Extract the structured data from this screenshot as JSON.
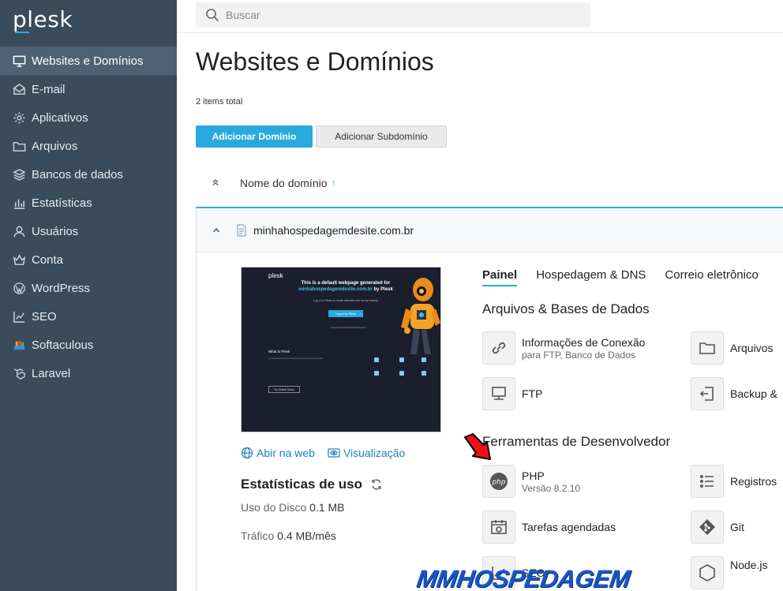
{
  "sidebar": {
    "logo": "plesk",
    "items": [
      {
        "label": "Websites e Domínios",
        "icon": "monitor-icon",
        "active": true
      },
      {
        "label": "E-mail",
        "icon": "envelope-icon"
      },
      {
        "label": "Aplicativos",
        "icon": "gear-icon"
      },
      {
        "label": "Arquivos",
        "icon": "folder-icon"
      },
      {
        "label": "Bancos de dados",
        "icon": "database-icon"
      },
      {
        "label": "Estatísticas",
        "icon": "bar-chart-icon"
      },
      {
        "label": "Usuários",
        "icon": "user-icon"
      },
      {
        "label": "Conta",
        "icon": "crown-icon"
      },
      {
        "label": "WordPress",
        "icon": "wordpress-icon"
      },
      {
        "label": "SEO",
        "icon": "trend-chart-icon"
      },
      {
        "label": "Softaculous",
        "icon": "softaculous-icon"
      },
      {
        "label": "Laravel",
        "icon": "laravel-icon"
      }
    ]
  },
  "search": {
    "placeholder": "Buscar"
  },
  "page": {
    "title": "Websites e Domínios",
    "items_total": "2 items total",
    "add_domain": "Adicionar Domínio",
    "add_subdomain": "Adicionar Subdomínio",
    "column_header": "Nome do domínio",
    "sort_arrow": "↑"
  },
  "domain": {
    "name": "minhahospedagemdesite.com.br",
    "open_web": "Abir na web",
    "preview": "Visualização",
    "thumbnail": {
      "logo": "plesk",
      "heading_1": "This is a default webpage generated for",
      "heading_2": "minhahospedagemdesite.com.br",
      "heading_3": " by Plesk",
      "sub": "Log in to Plesk to create websites and set up hosting",
      "button": "Log in to Plesk",
      "what": "What is Plesk",
      "demo": "Try Online Demo"
    },
    "stats": {
      "title": "Estatísticas de uso",
      "disk_label": "Uso do Disco",
      "disk_value": "0.1 MB",
      "traffic_label": "Tráfico",
      "traffic_value": "0.4 MB/mês"
    }
  },
  "tabs": [
    "Painel",
    "Hospedagem & DNS",
    "Correio eletrônico"
  ],
  "sections": {
    "files_db": "Arquivos & Bases de Dados",
    "dev_tools": "Ferramentas de Desenvolvedor"
  },
  "tools": {
    "connection": {
      "label": "Informações de Conexão",
      "sub": "para FTP, Banco de Dados",
      "icon": "link-icon"
    },
    "files": {
      "label": "Arquivos",
      "icon": "folder-icon"
    },
    "ftp": {
      "label": "FTP",
      "icon": "ftp-icon"
    },
    "backup": {
      "label": "Backup &",
      "icon": "backup-icon"
    },
    "php": {
      "label": "PHP",
      "sub": "Versão 8.2.10",
      "icon": "php-icon"
    },
    "logs": {
      "label": "Registros",
      "icon": "list-icon"
    },
    "cron": {
      "label": "Tarefas agendadas",
      "icon": "calendar-clock-icon"
    },
    "git": {
      "label": "Git",
      "icon": "git-icon"
    },
    "seo": {
      "label": "SEO",
      "icon": "trend-chart-icon"
    },
    "node": {
      "label": "Node.js",
      "icon": "nodejs-icon"
    }
  },
  "watermark": "MMHOSPEDAGEM",
  "colors": {
    "sidebar": "#3a4b5c",
    "accent": "#28aadf",
    "arrow": "#e11"
  }
}
